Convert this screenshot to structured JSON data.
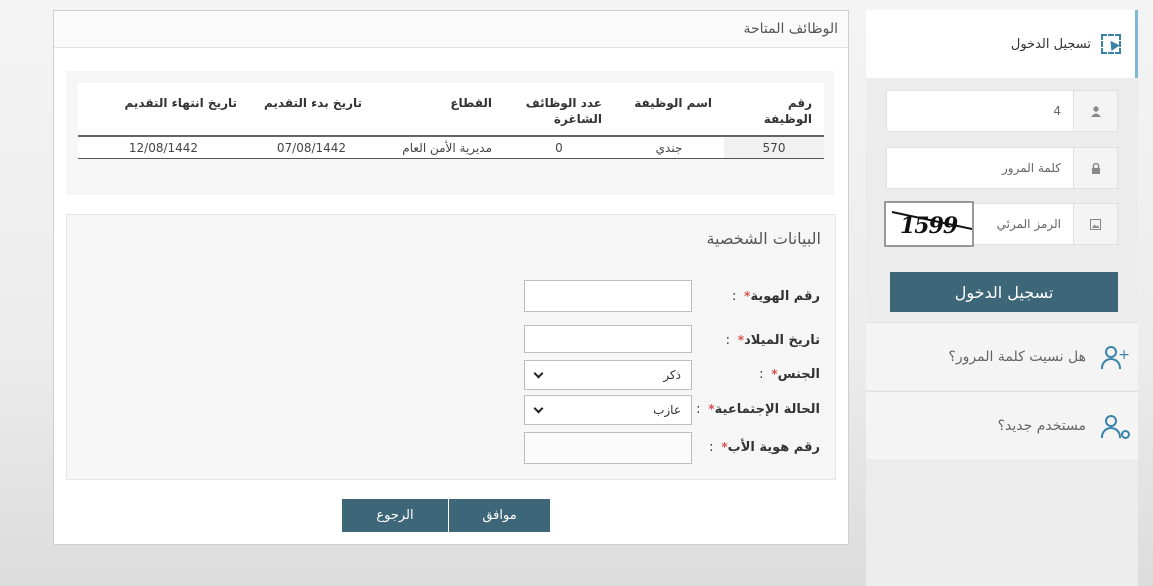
{
  "login": {
    "header_title": "تسجيل الدخول",
    "username_value": "4",
    "password_placeholder": "كلمة المرور",
    "captcha_placeholder": "الرمز المرئي",
    "captcha_text": "1599",
    "login_button": "تسجيل الدخول",
    "forgot_password": "هل نسيت كلمة المرور؟",
    "new_user": "مستخدم جديد؟"
  },
  "main": {
    "title": "الوظائف المتاحة",
    "jobs_table": {
      "headers": [
        "رقم الوظيفة",
        "اسم الوظيفة",
        "عدد الوظائف الشاغرة",
        "القطاع",
        "تاريخ بدء التقديم",
        "تاريخ انتهاء التقديم"
      ],
      "rows": [
        [
          "570",
          "جندي",
          "0",
          "مديرية الأمن العام",
          "07/08/1442",
          "12/08/1442"
        ]
      ]
    },
    "personal": {
      "title": "البيانات الشخصية",
      "fields": {
        "id_label": "رقم الهوية",
        "birth_label": "تاريخ الميلاد",
        "gender_label": "الجنس",
        "gender_value": "ذكر",
        "marital_label": "الحالة الإجتماعية",
        "marital_value": "عازب",
        "father_id_label": "رقم هوية الأب"
      }
    },
    "buttons": {
      "ok": "موافق",
      "back": "الرجوع"
    }
  },
  "colors": {
    "button_bg": "#3d6678",
    "accent": "#3a83a8",
    "required": "#d9534f"
  }
}
